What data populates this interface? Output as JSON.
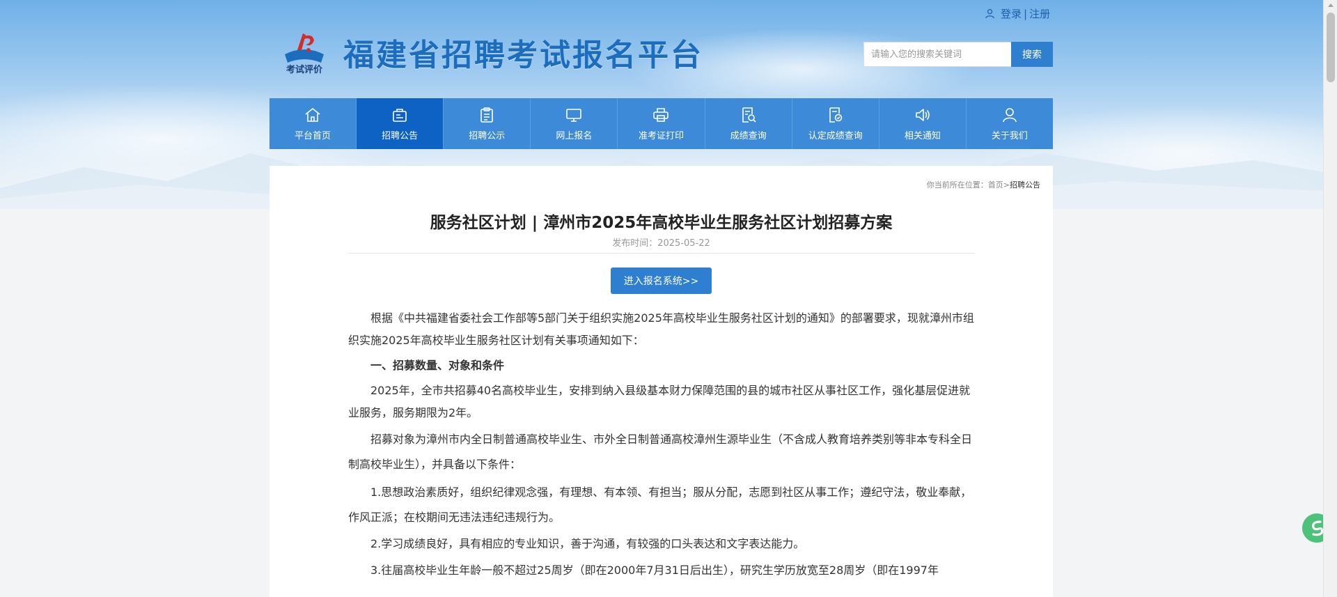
{
  "header": {
    "site_title": "福建省招聘考试报名平台",
    "logo_caption": "考试评价",
    "login_label": "登录",
    "separator": "|",
    "register_label": "注册"
  },
  "search": {
    "placeholder": "请输入您的搜索关键词",
    "button_label": "搜索"
  },
  "nav": {
    "items": [
      {
        "label": "平台首页",
        "icon": "home-icon"
      },
      {
        "label": "招聘公告",
        "icon": "announcement-icon",
        "active": true
      },
      {
        "label": "招聘公示",
        "icon": "clipboard-icon"
      },
      {
        "label": "网上报名",
        "icon": "monitor-icon"
      },
      {
        "label": "准考证打印",
        "icon": "printer-icon"
      },
      {
        "label": "成绩查询",
        "icon": "score-search-icon"
      },
      {
        "label": "认定成绩查询",
        "icon": "certified-score-icon"
      },
      {
        "label": "相关通知",
        "icon": "speaker-icon"
      },
      {
        "label": "关于我们",
        "icon": "user-icon"
      }
    ]
  },
  "breadcrumb": {
    "prefix": "你当前所在位置：",
    "home": "首页",
    "arrow": ">",
    "current": "招聘公告"
  },
  "article": {
    "title": "服务社区计划 | 漳州市2025年高校毕业生服务社区计划招募方案",
    "publish_time": "发布时间：2025-05-22",
    "enter_button": "进入报名系统>>",
    "paragraphs": [
      "根据《中共福建省委社会工作部等5部门关于组织实施2025年高校毕业生服务社区计划的通知》的部署要求，现就漳州市组织实施2025年高校毕业生服务社区计划有关事项通知如下：",
      "一、招募数量、对象和条件",
      "2025年，全市共招募40名高校毕业生，安排到纳入县级基本财力保障范围的县的城市社区从事社区工作，强化基层促进就业服务，服务期限为2年。",
      "招募对象为漳州市内全日制普通高校毕业生、市外全日制普通高校漳州生源毕业生（不含成人教育培养类别等非本专科全日制高校毕业生），并具备以下条件：",
      "1.思想政治素质好，组织纪律观念强，有理想、有本领、有担当；服从分配，志愿到社区从事工作；遵纪守法，敬业奉献，作风正派；在校期间无违法违纪违规行为。",
      "2.学习成绩良好，具有相应的专业知识，善于沟通，有较强的口头表达和文字表达能力。",
      "3.往届高校毕业生年龄一般不超过25周岁（即在2000年7月31日后出生），研究生学历放宽至28周岁（即在1997年"
    ]
  }
}
